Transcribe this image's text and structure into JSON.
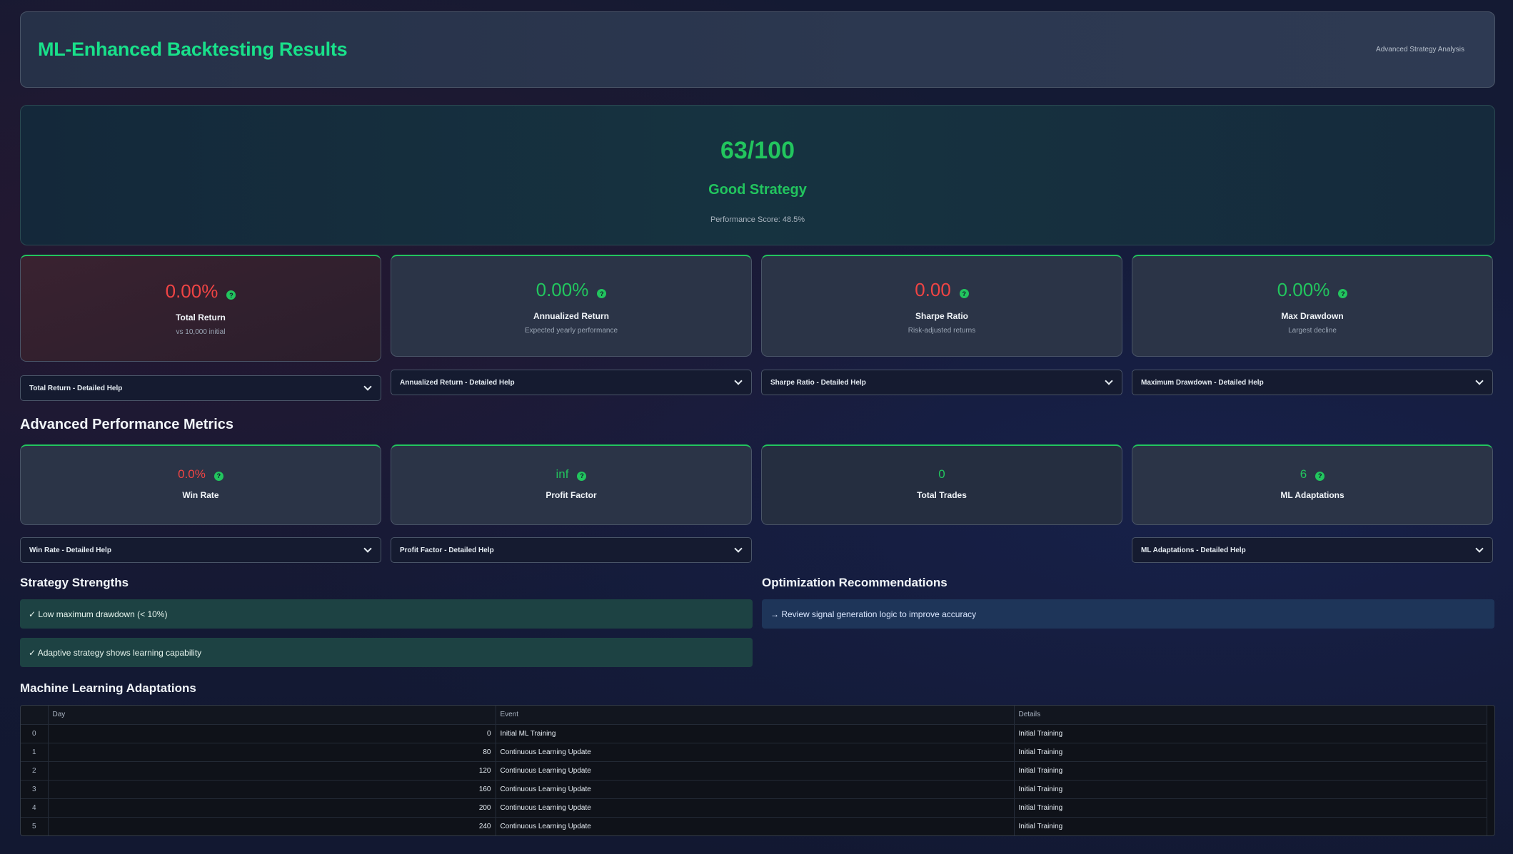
{
  "header": {
    "title": "ML-Enhanced Backtesting Results",
    "subtitle": "Advanced Strategy Analysis"
  },
  "score": {
    "value": "63/100",
    "label": "Good Strategy",
    "performance": "Performance Score: 48.5%"
  },
  "primary_metrics": [
    {
      "value": "0.00%",
      "name": "Total Return",
      "desc": "vs 10,000 initial",
      "status": "negative",
      "help": "Total Return - Detailed Help"
    },
    {
      "value": "0.00%",
      "name": "Annualized Return",
      "desc": "Expected yearly performance",
      "status": "positive",
      "help": "Annualized Return - Detailed Help"
    },
    {
      "value": "0.00",
      "name": "Sharpe Ratio",
      "desc": "Risk-adjusted returns",
      "status": "negative",
      "help": "Sharpe Ratio - Detailed Help"
    },
    {
      "value": "0.00%",
      "name": "Max Drawdown",
      "desc": "Largest decline",
      "status": "positive",
      "help": "Maximum Drawdown - Detailed Help"
    }
  ],
  "advanced_title": "Advanced Performance Metrics",
  "advanced_metrics": [
    {
      "value": "0.0%",
      "name": "Win Rate",
      "status": "negative",
      "help": "Win Rate - Detailed Help"
    },
    {
      "value": "inf",
      "name": "Profit Factor",
      "status": "positive",
      "help": "Profit Factor - Detailed Help"
    },
    {
      "value": "0",
      "name": "Total Trades",
      "status": "positive",
      "help": ""
    },
    {
      "value": "6",
      "name": "ML Adaptations",
      "status": "positive",
      "help": "ML Adaptations - Detailed Help"
    }
  ],
  "help_glyph": "?",
  "strengths": {
    "title": "Strategy Strengths",
    "items": [
      "✓ Low maximum drawdown (< 10%)",
      "✓ Adaptive strategy shows learning capability"
    ]
  },
  "recommendations": {
    "title": "Optimization Recommendations",
    "items": [
      "→ Review signal generation logic to improve accuracy"
    ]
  },
  "ml_table": {
    "title": "Machine Learning Adaptations",
    "columns": [
      "",
      "Day",
      "Event",
      "Details"
    ],
    "rows": [
      [
        "0",
        "0",
        "Initial ML Training",
        "Initial Training"
      ],
      [
        "1",
        "80",
        "Continuous Learning Update",
        "Initial Training"
      ],
      [
        "2",
        "120",
        "Continuous Learning Update",
        "Initial Training"
      ],
      [
        "3",
        "160",
        "Continuous Learning Update",
        "Initial Training"
      ],
      [
        "4",
        "200",
        "Continuous Learning Update",
        "Initial Training"
      ],
      [
        "5",
        "240",
        "Continuous Learning Update",
        "Initial Training"
      ]
    ]
  },
  "colors": {
    "accent_green": "#22c55e",
    "title_green": "#19e08a",
    "negative_red": "#ef4444"
  }
}
